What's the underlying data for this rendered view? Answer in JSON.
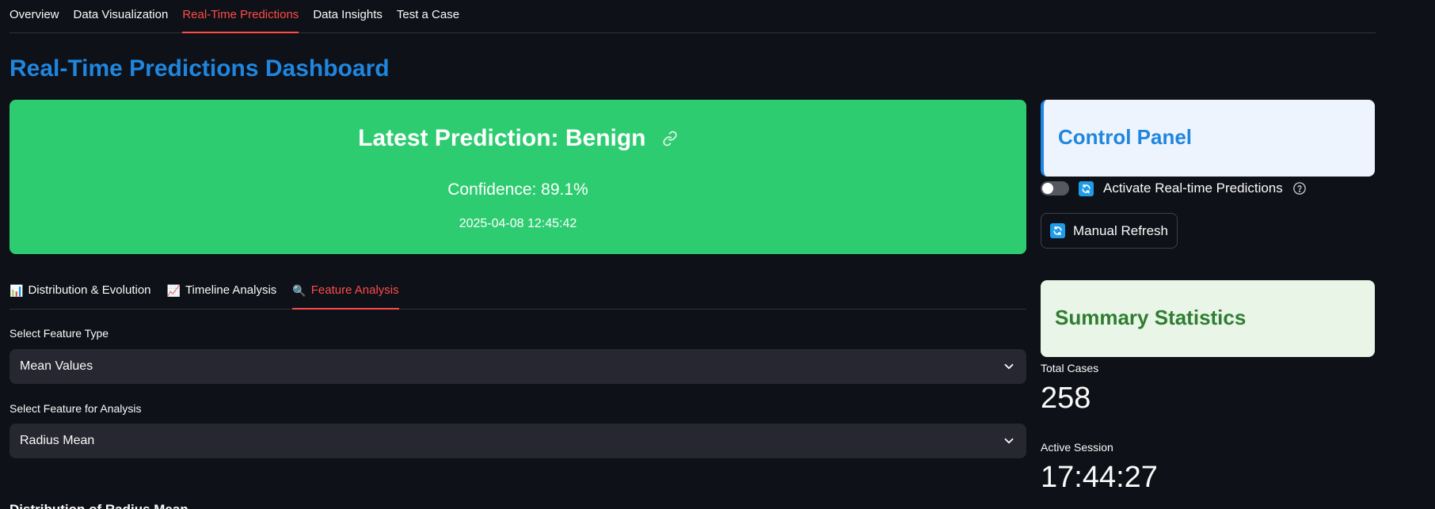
{
  "nav": {
    "tabs": [
      "Overview",
      "Data Visualization",
      "Real-Time Predictions",
      "Data Insights",
      "Test a Case"
    ],
    "active": "Real-Time Predictions"
  },
  "page": {
    "title": "Real-Time Predictions Dashboard"
  },
  "prediction": {
    "title": "Latest Prediction: Benign",
    "confidence": "Confidence: 89.1%",
    "timestamp": "2025-04-08 12:45:42",
    "color": "#2ecc71"
  },
  "subtabs": {
    "items": [
      {
        "icon": "📊",
        "label": "Distribution & Evolution"
      },
      {
        "icon": "📈",
        "label": "Timeline Analysis"
      },
      {
        "icon": "🔍",
        "label": "Feature Analysis"
      }
    ],
    "active": "Feature Analysis"
  },
  "feature_type": {
    "label": "Select Feature Type",
    "value": "Mean Values"
  },
  "feature": {
    "label": "Select Feature for Analysis",
    "value": "Radius Mean"
  },
  "section_heading": "Distribution of Radius Mean",
  "control_panel": {
    "title": "Control Panel",
    "toggle_label": "Activate Real-time Predictions",
    "toggle_on": false,
    "refresh_button": "Manual Refresh"
  },
  "summary": {
    "title": "Summary Statistics",
    "total_cases_label": "Total Cases",
    "total_cases_value": "258",
    "session_label": "Active Session",
    "session_value": "17:44:27"
  },
  "colors": {
    "accent_blue": "#1f86e0",
    "active_red": "#ff4b4b",
    "summary_green": "#2e7d32",
    "background": "#0e1117"
  }
}
